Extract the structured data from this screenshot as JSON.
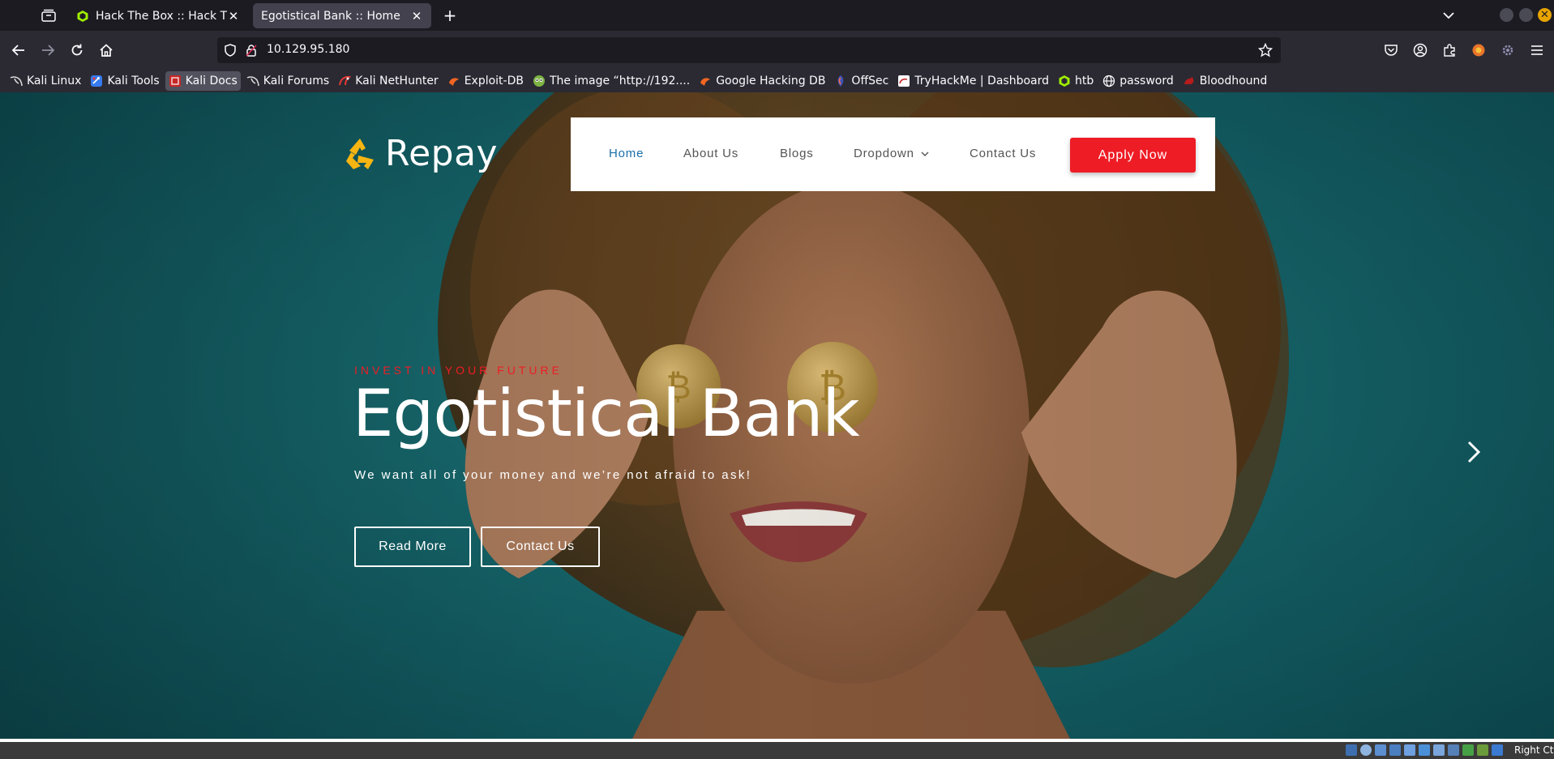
{
  "browser": {
    "tabs": [
      {
        "title": "Hack The Box :: Hack The Box",
        "active": false
      },
      {
        "title": "Egotistical Bank :: Home",
        "active": true
      }
    ],
    "url": "10.129.95.180"
  },
  "bookmarks": [
    {
      "label": "Kali Linux",
      "icon": "kali-dragon-icon"
    },
    {
      "label": "Kali Tools",
      "icon": "kali-tools-icon"
    },
    {
      "label": "Kali Docs",
      "icon": "kali-docs-icon"
    },
    {
      "label": "Kali Forums",
      "icon": "kali-dragon-icon"
    },
    {
      "label": "Kali NetHunter",
      "icon": "nethunter-icon"
    },
    {
      "label": "Exploit-DB",
      "icon": "exploit-db-icon"
    },
    {
      "label": "The image “http://192....",
      "icon": "image-icon"
    },
    {
      "label": "Google Hacking DB",
      "icon": "exploit-db-icon"
    },
    {
      "label": "OffSec",
      "icon": "offsec-icon"
    },
    {
      "label": "TryHackMe | Dashboard",
      "icon": "tryhackme-icon"
    },
    {
      "label": "htb",
      "icon": "htb-cube-icon"
    },
    {
      "label": "password",
      "icon": "globe-icon"
    },
    {
      "label": "Bloodhound",
      "icon": "bloodhound-icon"
    }
  ],
  "site": {
    "logo_text": "Repay",
    "nav": {
      "home": "Home",
      "about": "About Us",
      "blogs": "Blogs",
      "dropdown": "Dropdown",
      "contact": "Contact Us",
      "apply": "Apply Now"
    },
    "hero": {
      "kicker": "INVEST IN YOUR FUTURE",
      "title": "Egotistical Bank",
      "subtitle": "We want all of your money and we’re not afraid to ask!",
      "read_more": "Read More",
      "contact": "Contact Us"
    }
  },
  "statusbar": {
    "host_key": "Right Ctrl"
  },
  "colors": {
    "accent_red": "#ee1c25",
    "nav_active": "#1a6ea7",
    "hero_teal": "#135e64",
    "logo_yellow": "#f6b512"
  }
}
